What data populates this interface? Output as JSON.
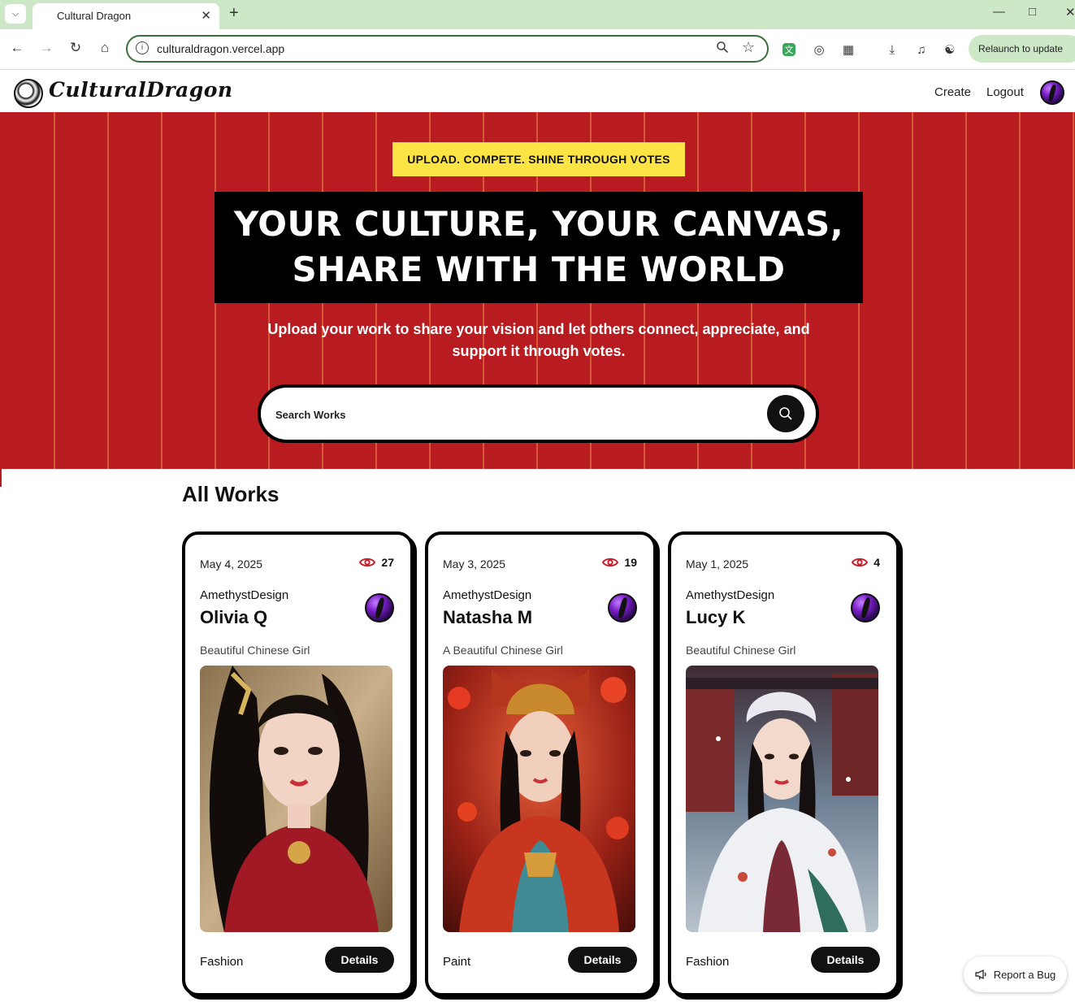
{
  "browser": {
    "tab_title": "Cultural Dragon",
    "url": "culturaldragon.vercel.app",
    "relaunch_label": "Relaunch to update"
  },
  "site": {
    "logo_text": "CulturalDragon",
    "nav": {
      "create": "Create",
      "logout": "Logout"
    }
  },
  "hero": {
    "tag": "UPLOAD. COMPETE. SHINE THROUGH VOTES",
    "title_line1": "YOUR CULTURE, YOUR CANVAS,",
    "title_line2": "SHARE WITH THE WORLD",
    "subtitle": "Upload your work to share your vision and let others connect, appreciate, and support it through votes.",
    "search_placeholder": "Search Works"
  },
  "works": {
    "title": "All Works",
    "details_label": "Details",
    "items": [
      {
        "date": "May 4, 2025",
        "views": "27",
        "author": "AmethystDesign",
        "name": "Olivia Q",
        "description": "Beautiful Chinese Girl",
        "category": "Fashion"
      },
      {
        "date": "May 3, 2025",
        "views": "19",
        "author": "AmethystDesign",
        "name": "Natasha M",
        "description": "A Beautiful Chinese Girl",
        "category": "Paint"
      },
      {
        "date": "May 1, 2025",
        "views": "4",
        "author": "AmethystDesign",
        "name": "Lucy K",
        "description": "Beautiful Chinese Girl",
        "category": "Fashion"
      }
    ]
  },
  "report_bug": "Report a Bug",
  "colors": {
    "hero_red": "#b81b20",
    "tag_yellow": "#fde445",
    "eye_red": "#c8202a"
  }
}
